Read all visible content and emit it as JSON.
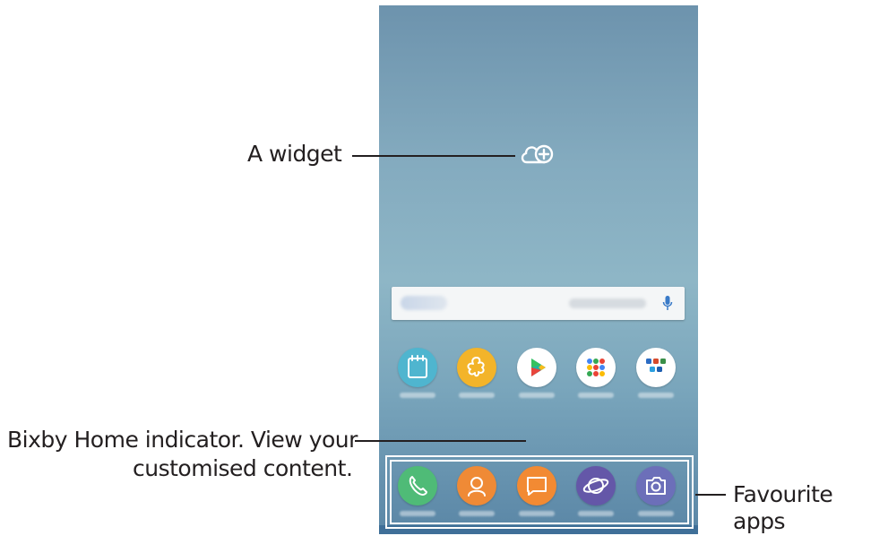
{
  "callouts": {
    "widget": "A widget",
    "bixby_line1": "Bixby Home indicator. View your",
    "bixby_line2": "customised content.",
    "favourites": "Favourite apps"
  },
  "icons": {
    "widget": "cloud-add-icon",
    "search_mic": "microphone-icon",
    "bixby": "home-indicator-icon"
  },
  "apps_row": [
    {
      "icon": "calendar-icon",
      "color": "#4fb5cf"
    },
    {
      "icon": "gallery-icon",
      "color": "#f3b42a"
    },
    {
      "icon": "play-store-icon",
      "color": "#ffffff"
    },
    {
      "icon": "google-folder-icon",
      "color": "#ffffff"
    },
    {
      "icon": "microsoft-folder-icon",
      "color": "#ffffff"
    }
  ],
  "dock_apps": [
    {
      "icon": "phone-icon",
      "color": "#4fbb77"
    },
    {
      "icon": "contacts-icon",
      "color": "#ef8a36"
    },
    {
      "icon": "messages-icon",
      "color": "#f28a33"
    },
    {
      "icon": "internet-icon",
      "color": "#6457a8"
    },
    {
      "icon": "camera-icon",
      "color": "#6c6fb9"
    }
  ],
  "colors": {
    "accent_blue": "#3a7bc8",
    "callout_text": "#231f20",
    "dock_border": "#ffffff"
  }
}
